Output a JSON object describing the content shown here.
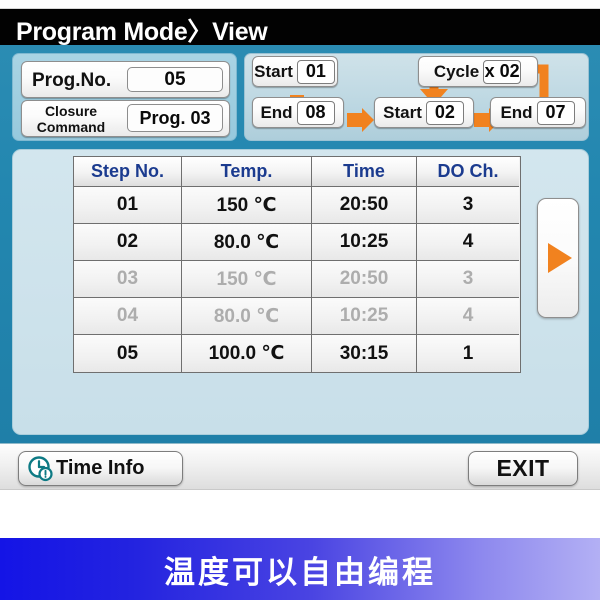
{
  "window": {
    "title": "Program Mode〉View"
  },
  "params": {
    "prog_no_label": "Prog.No.",
    "prog_no_value": "05",
    "closure_label_line1": "Closure",
    "closure_label_line2": "Command",
    "closure_value": "Prog. 03"
  },
  "flow": {
    "start1_label": "Start",
    "start1_value": "01",
    "end1_label": "End",
    "end1_value": "08",
    "start2_label": "Start",
    "start2_value": "02",
    "end2_label": "End",
    "end2_value": "07",
    "cycle_label": "Cycle",
    "cycle_value": "x 02",
    "arrow_color": "#f1821f"
  },
  "table": {
    "headers": [
      "Step No.",
      "Temp.",
      "Time",
      "DO Ch."
    ],
    "header_color": "#1b3b8f",
    "rows": [
      {
        "step": "01",
        "temp": "150 ℃",
        "time": "20:50",
        "do_ch": "3",
        "dimmed": false
      },
      {
        "step": "02",
        "temp": "80.0 ℃",
        "time": "10:25",
        "do_ch": "4",
        "dimmed": false
      },
      {
        "step": "03",
        "temp": "150 ℃",
        "time": "20:50",
        "do_ch": "3",
        "dimmed": true
      },
      {
        "step": "04",
        "temp": "80.0 ℃",
        "time": "10:25",
        "do_ch": "4",
        "dimmed": true
      },
      {
        "step": "05",
        "temp": "100.0 ℃",
        "time": "30:15",
        "do_ch": "1",
        "dimmed": false
      }
    ]
  },
  "scroll": {
    "next_icon": "triangle-right-icon"
  },
  "toolbar": {
    "time_info_label": "Time Info",
    "time_info_icon": "clock-alert-icon",
    "exit_label": "EXIT"
  },
  "caption": {
    "text": "温度可以自由编程"
  }
}
